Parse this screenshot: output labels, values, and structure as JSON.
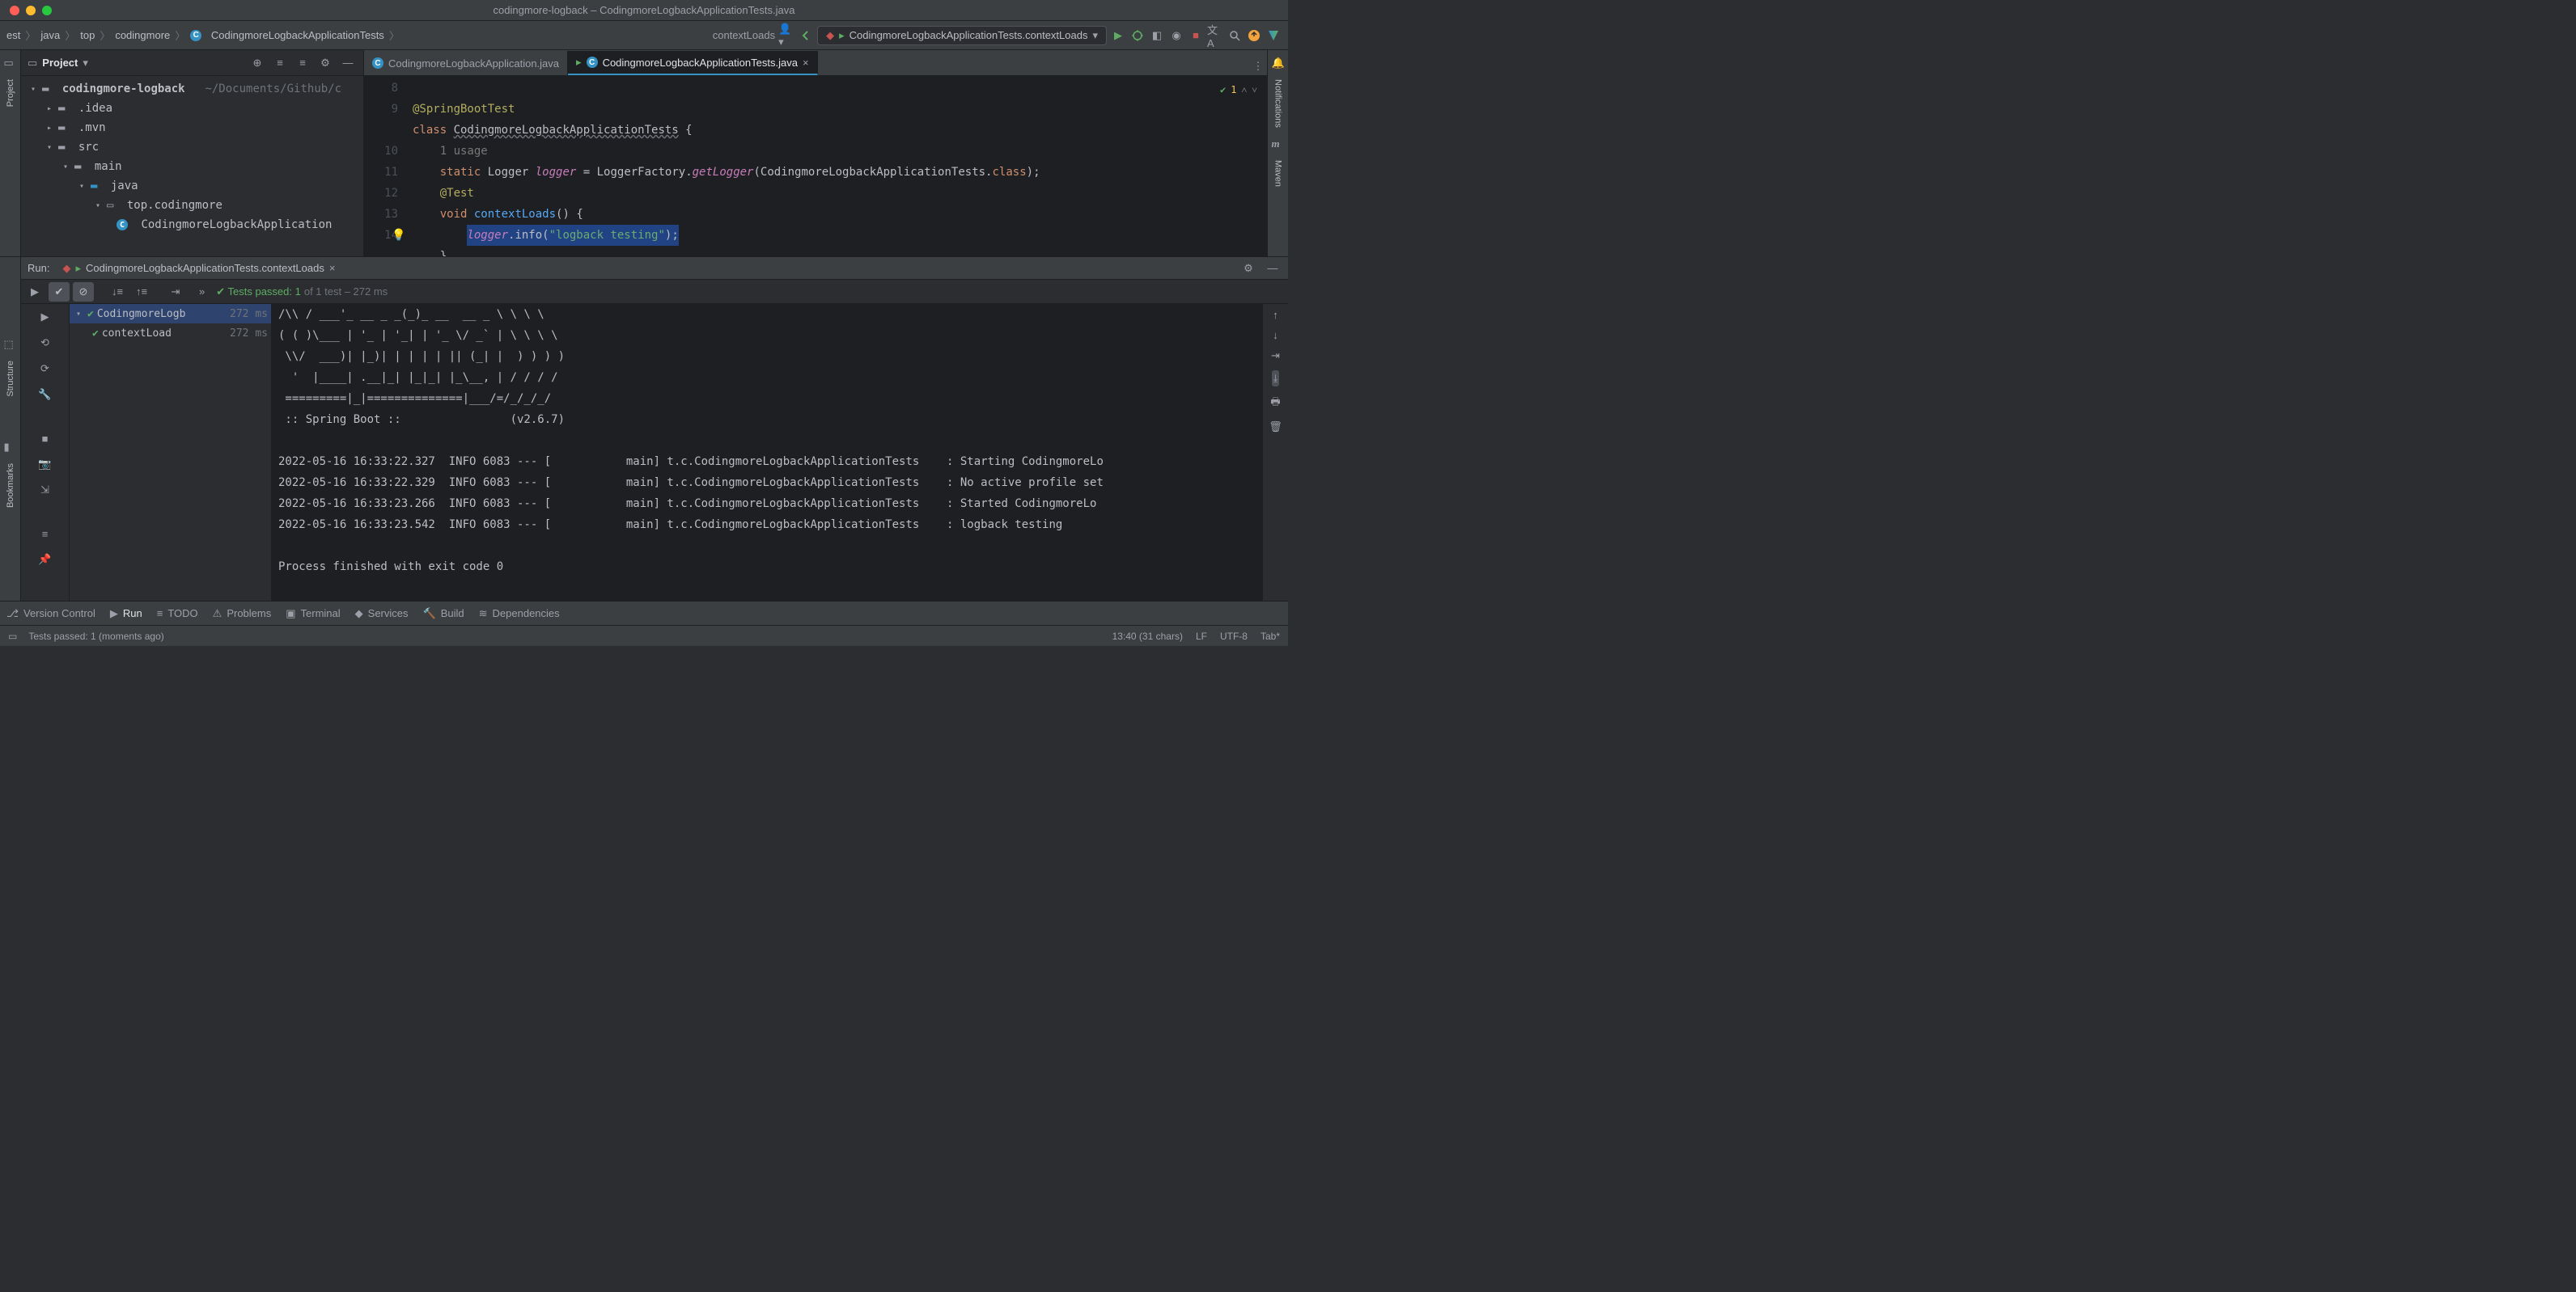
{
  "window": {
    "title": "codingmore-logback – CodingmoreLogbackApplicationTests.java"
  },
  "breadcrumbs": [
    "est",
    "java",
    "top",
    "codingmore",
    "CodingmoreLogbackApplicationTests",
    "contextLoads"
  ],
  "run_config": {
    "label": "CodingmoreLogbackApplicationTests.contextLoads"
  },
  "project": {
    "title": "Project",
    "root": "codingmore-logback",
    "root_path": "~/Documents/Github/c",
    "tree": {
      "idea": ".idea",
      "mvn": ".mvn",
      "src": "src",
      "main": "main",
      "java": "java",
      "pkg": "top.codingmore",
      "class": "CodingmoreLogbackApplication"
    }
  },
  "editor": {
    "tabs": [
      {
        "name": "CodingmoreLogbackApplication.java",
        "active": false
      },
      {
        "name": "CodingmoreLogbackApplicationTests.java",
        "active": true
      }
    ],
    "gutter_start": 8,
    "lines": {
      "l8": "@SpringBootTest",
      "l9_cls": "class ",
      "l9_name": "CodingmoreLogbackApplicationTests",
      "l9_end": " {",
      "l_usage": "1 usage",
      "l10_a": "static ",
      "l10_b": "Logger ",
      "l10_c": "logger",
      "l10_d": " = LoggerFactory.",
      "l10_e": "getLogger",
      "l10_f": "(CodingmoreLogbackApplicationTests.",
      "l10_g": "class",
      "l10_h": ");",
      "l11": "@Test",
      "l12_a": "void ",
      "l12_b": "contextLoads",
      "l12_c": "() {",
      "l13_a": "logger",
      "l13_b": ".info(",
      "l13_c": "\"logback testing\"",
      "l13_d": ");",
      "l14": "}"
    },
    "warn_count": "1"
  },
  "run": {
    "header_label": "Run:",
    "tab": "CodingmoreLogbackApplicationTests.contextLoads",
    "tests_summary_a": "Tests passed: 1",
    "tests_summary_b": " of 1 test – 272 ms",
    "tree": {
      "root": "CodingmoreLogb",
      "root_time": "272 ms",
      "child": "contextLoad",
      "child_time": "272 ms"
    },
    "console_lines": [
      "/\\\\ / ___'_ __ _ _(_)_ __  __ _ \\ \\ \\ \\",
      "( ( )\\___ | '_ | '_| | '_ \\/ _` | \\ \\ \\ \\",
      " \\\\/  ___)| |_)| | | | | || (_| |  ) ) ) )",
      "  '  |____| .__|_| |_|_| |_\\__, | / / / /",
      " =========|_|==============|___/=/_/_/_/",
      " :: Spring Boot ::                (v2.6.7)",
      "",
      "2022-05-16 16:33:22.327  INFO 6083 --- [           main] t.c.CodingmoreLogbackApplicationTests    : Starting CodingmoreLo",
      "2022-05-16 16:33:22.329  INFO 6083 --- [           main] t.c.CodingmoreLogbackApplicationTests    : No active profile set",
      "2022-05-16 16:33:23.266  INFO 6083 --- [           main] t.c.CodingmoreLogbackApplicationTests    : Started CodingmoreLo",
      "2022-05-16 16:33:23.542  INFO 6083 --- [           main] t.c.CodingmoreLogbackApplicationTests    : logback testing",
      "",
      "Process finished with exit code 0"
    ]
  },
  "tool_tabs": [
    "Version Control",
    "Run",
    "TODO",
    "Problems",
    "Terminal",
    "Services",
    "Build",
    "Dependencies"
  ],
  "status": {
    "msg": "Tests passed: 1 (moments ago)",
    "pos": "13:40 (31 chars)",
    "sep": "LF",
    "enc": "UTF-8",
    "indent": "Tab*"
  },
  "side_tools": {
    "left_top": "Project",
    "left_mid": "Structure",
    "left_bot": "Bookmarks",
    "right_top": "Notifications",
    "right_bot": "Maven"
  }
}
